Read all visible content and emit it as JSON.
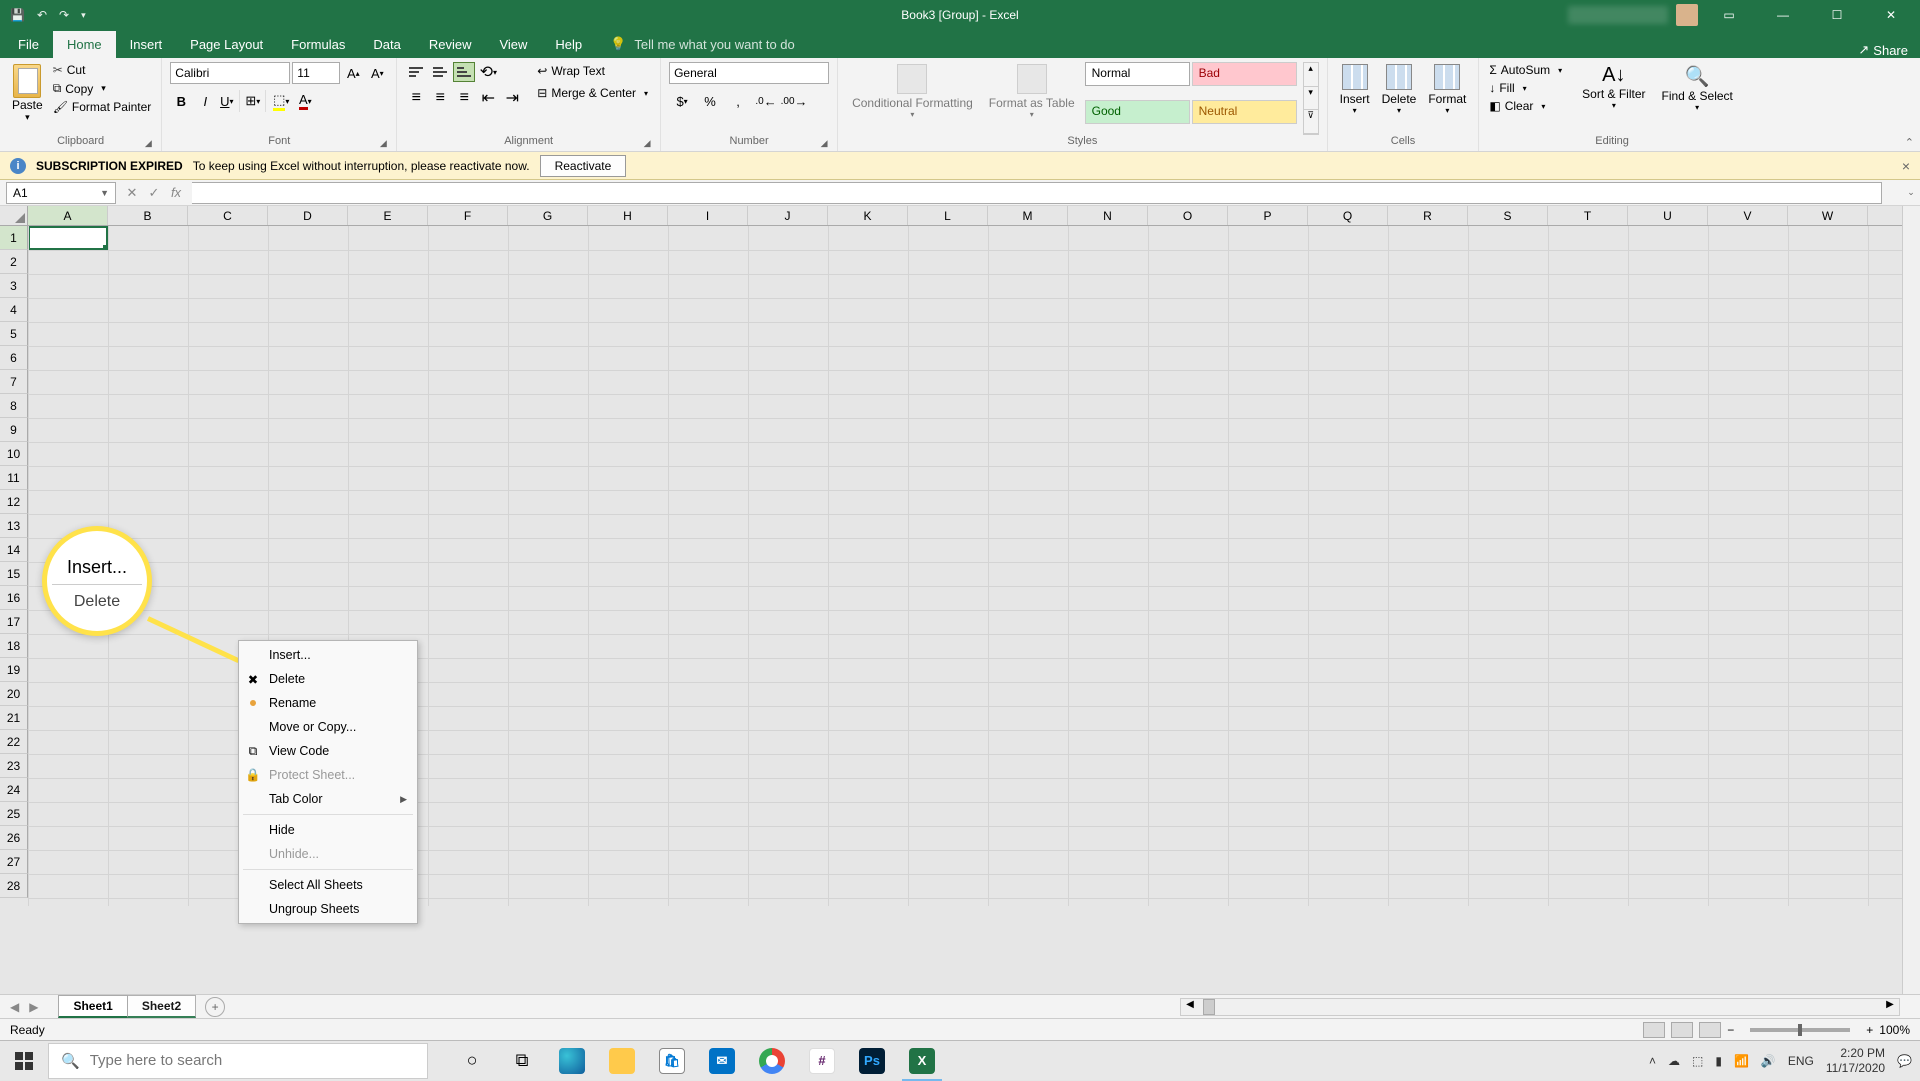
{
  "title": "Book3  [Group]  -  Excel",
  "qat": {
    "save": "💾",
    "undo": "↶",
    "redo": "↷"
  },
  "tabs": {
    "file": "File",
    "home": "Home",
    "insert": "Insert",
    "page_layout": "Page Layout",
    "formulas": "Formulas",
    "data": "Data",
    "review": "Review",
    "view": "View",
    "help": "Help",
    "tell_me": "Tell me what you want to do",
    "share": "Share"
  },
  "ribbon": {
    "clipboard": {
      "label": "Clipboard",
      "paste": "Paste",
      "cut": "Cut",
      "copy": "Copy",
      "format_painter": "Format Painter"
    },
    "font": {
      "label": "Font",
      "name": "Calibri",
      "size": "11"
    },
    "alignment": {
      "label": "Alignment",
      "wrap": "Wrap Text",
      "merge": "Merge & Center"
    },
    "number": {
      "label": "Number",
      "format": "General"
    },
    "styles": {
      "label": "Styles",
      "conditional": "Conditional Formatting",
      "format_as": "Format as Table",
      "normal": "Normal",
      "bad": "Bad",
      "good": "Good",
      "neutral": "Neutral"
    },
    "cells": {
      "label": "Cells",
      "insert": "Insert",
      "delete": "Delete",
      "format": "Format"
    },
    "editing": {
      "label": "Editing",
      "autosum": "AutoSum",
      "fill": "Fill",
      "clear": "Clear",
      "sort": "Sort & Filter",
      "find": "Find & Select"
    }
  },
  "subscription": {
    "title": "SUBSCRIPTION EXPIRED",
    "msg": "To keep using Excel without interruption, please reactivate now.",
    "btn": "Reactivate"
  },
  "namebox": "A1",
  "columns": [
    "A",
    "B",
    "C",
    "D",
    "E",
    "F",
    "G",
    "H",
    "I",
    "J",
    "K",
    "L",
    "M",
    "N",
    "O",
    "P",
    "Q",
    "R",
    "S",
    "T",
    "U",
    "V",
    "W"
  ],
  "row_count": 28,
  "context_menu": {
    "insert": "Insert...",
    "delete": "Delete",
    "rename": "Rename",
    "move": "Move or Copy...",
    "view_code": "View Code",
    "protect": "Protect Sheet...",
    "tab_color": "Tab Color",
    "hide": "Hide",
    "unhide": "Unhide...",
    "select_all": "Select All Sheets",
    "ungroup": "Ungroup Sheets"
  },
  "callout": {
    "main": "Insert...",
    "sub": "Delete"
  },
  "sheets": {
    "s1": "Sheet1",
    "s2": "Sheet2"
  },
  "status": {
    "ready": "Ready",
    "zoom": "100%"
  },
  "taskbar": {
    "search": "Type here to search",
    "lang": "ENG",
    "time": "2:20 PM",
    "date": "11/17/2020"
  }
}
